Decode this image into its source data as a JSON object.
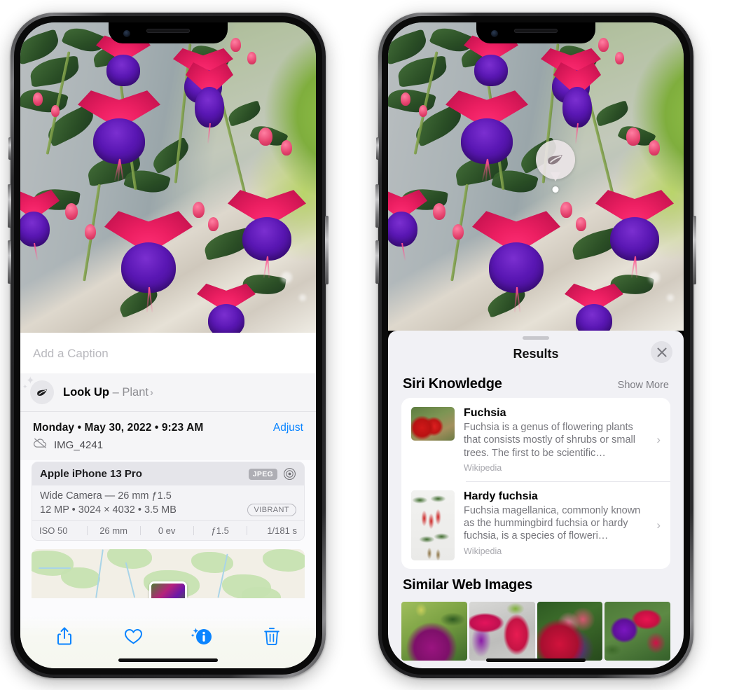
{
  "left_phone": {
    "caption_placeholder": "Add a Caption",
    "lookup": {
      "title": "Look Up",
      "dash": " – ",
      "subject": "Plant",
      "chevron": "›",
      "icon": "leaf-icon"
    },
    "date_line": "Monday • May 30, 2022 • 9:23 AM",
    "adjust_label": "Adjust",
    "file_name": "IMG_4241",
    "cloud_icon": "cloud-slash-icon",
    "camera_card": {
      "model": "Apple iPhone 13 Pro",
      "format_badge": "JPEG",
      "aperture_icon": "aperture-icon",
      "lens_line": "Wide Camera — 26 mm ƒ1.5",
      "specs_line": "12 MP • 3024 × 4032 • 3.5 MB",
      "style_badge": "VIBRANT",
      "exif": [
        "ISO 50",
        "26 mm",
        "0 ev",
        "ƒ1.5",
        "1/181 s"
      ]
    },
    "toolbar": [
      {
        "name": "share-button",
        "icon": "share-icon"
      },
      {
        "name": "favorite-button",
        "icon": "heart-icon"
      },
      {
        "name": "info-button",
        "icon": "info-sparkle-icon"
      },
      {
        "name": "delete-button",
        "icon": "trash-icon"
      }
    ]
  },
  "right_phone": {
    "visual_lookup_badge": {
      "icon": "leaf-icon"
    },
    "sheet": {
      "title": "Results",
      "close_icon": "close-icon",
      "siri_knowledge": {
        "heading": "Siri Knowledge",
        "action": "Show More",
        "items": [
          {
            "title": "Fuchsia",
            "description": "Fuchsia is a genus of flowering plants that consists mostly of shrubs or small trees. The first to be scientific…",
            "source": "Wikipedia",
            "chevron": "›"
          },
          {
            "title": "Hardy fuchsia",
            "description": "Fuchsia magellanica, commonly known as the hummingbird fuchsia or hardy fuchsia, is a species of floweri…",
            "source": "Wikipedia",
            "chevron": "›"
          }
        ]
      },
      "similar_web_images": {
        "heading": "Similar Web Images",
        "count": 4
      }
    }
  },
  "colors": {
    "accent_blue": "#0a84ff",
    "sheet_bg": "#f1f1f5",
    "panel_bg": "#f5f5f7",
    "card_bg": "#ffffff",
    "secondary_text": "#8e8e93"
  }
}
